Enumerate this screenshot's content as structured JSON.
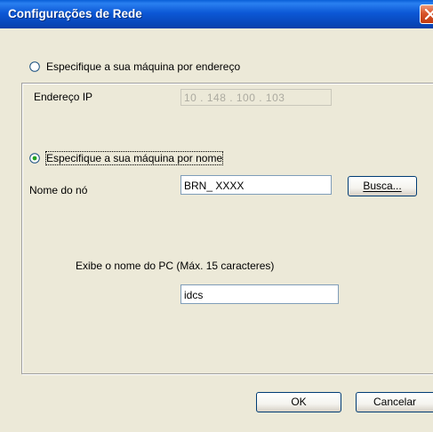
{
  "window": {
    "title": "Configurações de Rede"
  },
  "address_option": {
    "radio_label": "Especifique a sua máquina por endereço",
    "selected": false,
    "ip_label": "Endereço IP",
    "ip_value": "10 . 148 . 100 . 103"
  },
  "name_option": {
    "radio_label": "Especifique a sua máquina por nome",
    "selected": true,
    "node_label": "Nome do nó",
    "node_value": "BRN_  XXXX",
    "search_button": "Busca..."
  },
  "pc_name": {
    "label": "Exibe o nome do PC (Máx. 15 caracteres)",
    "value": "idcs"
  },
  "buttons": {
    "ok": "OK",
    "cancel": "Cancelar"
  },
  "colors": {
    "titlebar": "#0846b8",
    "dialog_bg": "#ece9d8",
    "close_button": "#d8542a"
  },
  "icons": [
    "close-icon",
    "radio-unchecked",
    "radio-checked"
  ]
}
